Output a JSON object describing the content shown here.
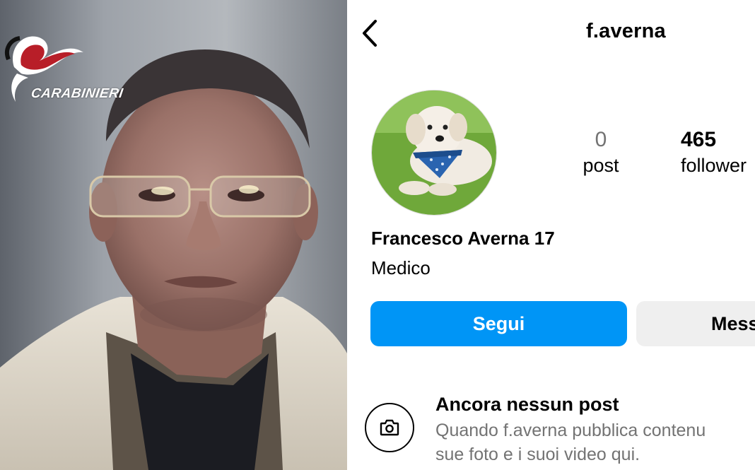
{
  "photo": {
    "logo_text": "CARABINIERI"
  },
  "header": {
    "username": "f.averna",
    "back_icon": "chevron-left-icon"
  },
  "stats": {
    "posts_value": "0",
    "posts_label": "post",
    "followers_value": "465",
    "followers_label": "follower"
  },
  "profile": {
    "full_name": "Francesco Averna 17",
    "bio": "Medico"
  },
  "actions": {
    "follow_label": "Segui",
    "message_label": "Mess"
  },
  "empty_state": {
    "icon": "camera-icon",
    "title": "Ancora nessun post",
    "description_line1": "Quando f.averna pubblica contenu",
    "description_line2": "sue foto e i suoi video qui."
  },
  "colors": {
    "follow_button": "#0095f6",
    "message_button": "#efefef",
    "secondary_text": "#737373"
  }
}
